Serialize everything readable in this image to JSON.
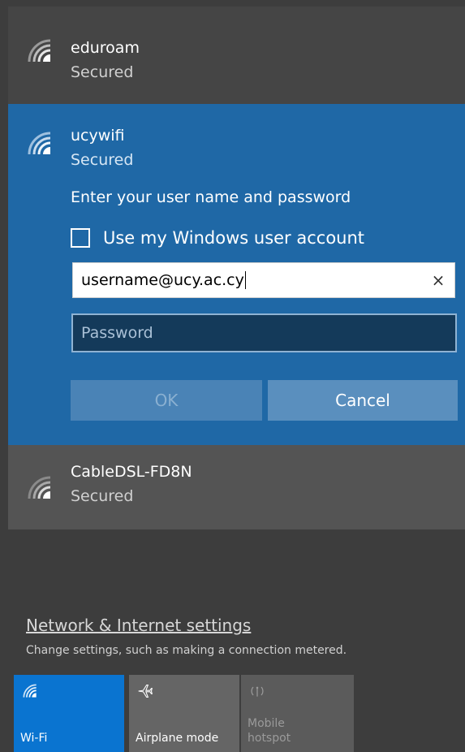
{
  "networks": [
    {
      "name": "eduroam",
      "status": "Secured"
    },
    {
      "name": "ucywifi",
      "status": "Secured"
    },
    {
      "name": "CableDSL-FD8N",
      "status": "Secured"
    }
  ],
  "connect_form": {
    "prompt": "Enter your user name and password",
    "checkbox_label": "Use my Windows user account",
    "checkbox_checked": false,
    "username_value": "username@ucy.ac.cy",
    "clear_symbol": "×",
    "password_placeholder": "Password",
    "ok_label": "OK",
    "cancel_label": "Cancel"
  },
  "settings": {
    "link": "Network & Internet settings",
    "description": "Change settings, such as making a connection metered."
  },
  "quick_actions": [
    {
      "label": "Wi-Fi",
      "icon": "wifi-icon",
      "active": true
    },
    {
      "label": "Airplane mode",
      "icon": "airplane-icon",
      "active": false
    },
    {
      "label": "Mobile\nhotspot",
      "icon": "hotspot-icon",
      "active": false
    }
  ],
  "colors": {
    "accent": "#0a74d0",
    "selected_network_bg": "#1f68a6"
  }
}
